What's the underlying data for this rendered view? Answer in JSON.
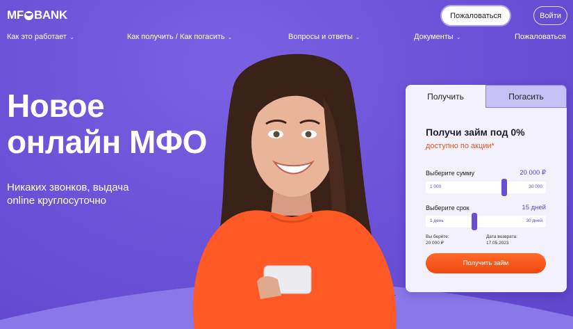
{
  "header": {
    "logo_left": "MF",
    "logo_right": "BANK",
    "complain_button": "Пожаловаться",
    "login_button": "Войти"
  },
  "nav": {
    "items": [
      {
        "label": "Как это работает",
        "has_dropdown": true
      },
      {
        "label": "Как получить / Как погасить",
        "has_dropdown": true
      },
      {
        "label": "Вопросы и ответы",
        "has_dropdown": true
      },
      {
        "label": "Документы",
        "has_dropdown": true
      },
      {
        "label": "Пожаловаться",
        "has_dropdown": false
      }
    ],
    "chevron": "⌄"
  },
  "hero": {
    "title_line1": "Новое",
    "title_line2": "онлайн МФО",
    "subtitle_line1": "Никаких звонков, выдача",
    "subtitle_line2": "online круглосуточно"
  },
  "card": {
    "tabs": [
      {
        "label": "Получить",
        "active": true
      },
      {
        "label": "Погасить",
        "active": false
      }
    ],
    "title": "Получи займ под 0%",
    "promo": "доступно по акции*",
    "amount": {
      "label": "Выберите сумму",
      "value": "20 000 ₽",
      "min": "1 000",
      "max": "30 000",
      "fraction": 0.66
    },
    "term": {
      "label": "Выберите срок",
      "value": "15 дней",
      "min": "1 день",
      "max": "30 дней",
      "fraction": 0.4
    },
    "take_label": "Вы берёте:",
    "take_value": "20 000 ₽",
    "return_label": "Дата возврата:",
    "return_value": "17.05.2023",
    "submit": "Получить займ"
  },
  "colors": {
    "background": "#6a50d6",
    "accent": "#f0490f",
    "slider_thumb": "#6a4fd3"
  }
}
